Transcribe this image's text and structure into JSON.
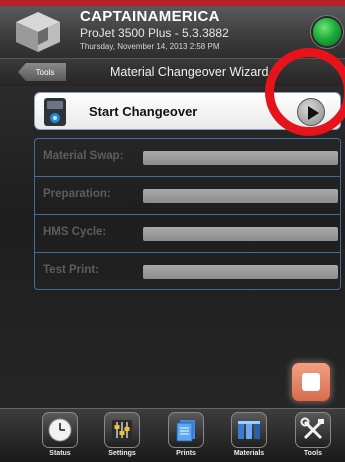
{
  "header": {
    "printer_name": "CAPTAINAMERICA",
    "model": "ProJet 3500 Plus - 5.3.3882",
    "datetime": "Thursday, November 14, 2013 2:58 PM"
  },
  "subbar": {
    "back_label": "Tools",
    "title": "Material Changeover Wizard"
  },
  "wizard": {
    "start_label": "Start Changeover",
    "steps": [
      {
        "label": "Material Swap:"
      },
      {
        "label": "Preparation:"
      },
      {
        "label": "HMS Cycle:"
      },
      {
        "label": "Test Print:"
      }
    ]
  },
  "nav": {
    "items": [
      {
        "label": "Status",
        "icon": "clock-icon"
      },
      {
        "label": "Settings",
        "icon": "sliders-icon"
      },
      {
        "label": "Prints",
        "icon": "documents-icon"
      },
      {
        "label": "Materials",
        "icon": "cartridges-icon"
      },
      {
        "label": "Tools",
        "icon": "tools-icon"
      }
    ]
  },
  "colors": {
    "accent_red": "#e6131a",
    "status_green": "#1fae3a",
    "step_border": "#3f6d9c"
  }
}
